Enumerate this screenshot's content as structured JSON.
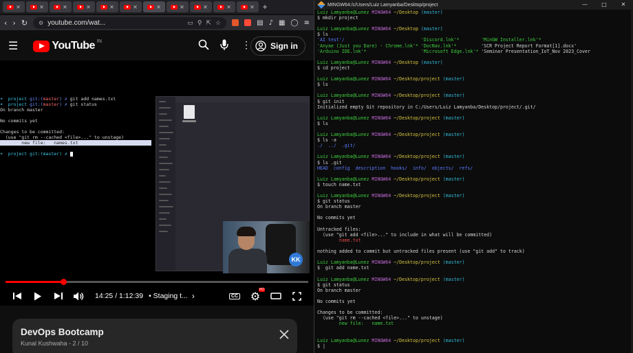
{
  "browser": {
    "tabs": [
      "yt",
      "yt",
      "yt",
      "yt",
      "yt",
      "yt",
      "yt",
      "yt",
      "yt",
      "yt",
      "yt"
    ],
    "url": "youtube.com/wat...",
    "nav_back": "‹",
    "nav_forward": "›",
    "reload": "↻"
  },
  "youtube": {
    "logo_text": "YouTube",
    "country": "IN",
    "signin_label": "Sign in",
    "video_terminal": [
      {
        "prompt": "➜  project ",
        "git": "git:(",
        "branch": "master",
        "end": ") ✗ ",
        "cmd": "git add names.txt"
      },
      {
        "prompt": "➜  project ",
        "git": "git:(",
        "branch": "master",
        "end": ") ✗ ",
        "cmd": "git status"
      }
    ],
    "video_lines": [
      "On branch master",
      "",
      "No commits yet",
      "",
      "Changes to be committed:",
      "  (use \"git rm --cached <file>...\" to unstage)"
    ],
    "video_highlight": "        new file:   names.txt",
    "video_last_prompt": "➜  project git:(master) ✗ ",
    "webcam_badge": "KK",
    "progress": 0.19,
    "timecode": "14:25 / 1:12:39",
    "chapter": "• Staging t...",
    "playlist_title": "DevOps Bootcamp",
    "playlist_sub": "Kunal Kushwaha - 2 / 10"
  },
  "terminal": {
    "title": "MINGW64:/c/Users/Luiz Lamyanba/Desktop/project",
    "lines": [
      {
        "t": "prompt",
        "path": "~/Desktop",
        "branch": "(master)"
      },
      {
        "t": "text",
        "v": "$ mkdir project"
      },
      {
        "t": "blank"
      },
      {
        "t": "prompt",
        "path": "~/Desktop",
        "branch": "(master)"
      },
      {
        "t": "text",
        "v": "$ ls"
      },
      {
        "t": "ls",
        "v": [
          [
            "'AI test'/",
            "'Discord.lnk'*",
            "'MinGW Installer.lnk'*"
          ],
          [
            "'Anyae (Just you Dare) - Chrome.lnk'*",
            "'DocNav.lnk'*",
            "'SCR Project Report Format[1].docx'"
          ],
          [
            "'Arduino IDE.lnk'*",
            "'Microsoft Edge.lnk'*",
            "'Seminar Presentation_IoT_Nov 2023_Cover"
          ]
        ]
      },
      {
        "t": "blank"
      },
      {
        "t": "prompt",
        "path": "~/Desktop",
        "branch": "(master)"
      },
      {
        "t": "text",
        "v": "$ cd project"
      },
      {
        "t": "blank"
      },
      {
        "t": "prompt",
        "path": "~/Desktop/project",
        "branch": "(master)"
      },
      {
        "t": "text",
        "v": "$ ls"
      },
      {
        "t": "blank"
      },
      {
        "t": "prompt",
        "path": "~/Desktop/project",
        "branch": "(master)"
      },
      {
        "t": "text",
        "v": "$ git init"
      },
      {
        "t": "text",
        "v": "Initialized empty Git repository in C:/Users/Luiz Lamyanba/Desktop/project/.git/"
      },
      {
        "t": "blank"
      },
      {
        "t": "prompt",
        "path": "~/Desktop/project",
        "branch": "(master)"
      },
      {
        "t": "text",
        "v": "$ ls"
      },
      {
        "t": "blank"
      },
      {
        "t": "prompt",
        "path": "~/Desktop/project",
        "branch": "(master)"
      },
      {
        "t": "text",
        "v": "$ ls -a"
      },
      {
        "t": "dirs",
        "v": "./  ../  .git/"
      },
      {
        "t": "blank"
      },
      {
        "t": "prompt",
        "path": "~/Desktop/project",
        "branch": "(master)"
      },
      {
        "t": "text",
        "v": "$ ls .git"
      },
      {
        "t": "gitls",
        "v": "HEAD  config  description  hooks/  info/  objects/  refs/"
      },
      {
        "t": "blank"
      },
      {
        "t": "prompt",
        "path": "~/Desktop/project",
        "branch": "(master)"
      },
      {
        "t": "text",
        "v": "$ touch name.txt"
      },
      {
        "t": "blank"
      },
      {
        "t": "prompt",
        "path": "~/Desktop/project",
        "branch": "(master)"
      },
      {
        "t": "text",
        "v": "$ git status"
      },
      {
        "t": "text",
        "v": "On branch master"
      },
      {
        "t": "blank"
      },
      {
        "t": "text",
        "v": "No commits yet"
      },
      {
        "t": "blank"
      },
      {
        "t": "text",
        "v": "Untracked files:"
      },
      {
        "t": "text",
        "v": "  (use \"git add <file>...\" to include in what will be committed)"
      },
      {
        "t": "red",
        "v": "        name.txt"
      },
      {
        "t": "blank"
      },
      {
        "t": "text",
        "v": "nothing added to commit but untracked files present (use \"git add\" to track)"
      },
      {
        "t": "blank"
      },
      {
        "t": "prompt",
        "path": "~/Desktop/project",
        "branch": "(master)"
      },
      {
        "t": "text",
        "v": "$  git add name.txt"
      },
      {
        "t": "blank"
      },
      {
        "t": "prompt",
        "path": "~/Desktop/project",
        "branch": "(master)"
      },
      {
        "t": "text",
        "v": "$ git status"
      },
      {
        "t": "text",
        "v": "On branch master"
      },
      {
        "t": "blank"
      },
      {
        "t": "text",
        "v": "No commits yet"
      },
      {
        "t": "blank"
      },
      {
        "t": "text",
        "v": "Changes to be committed:"
      },
      {
        "t": "text",
        "v": "  (use \"git rm --cached <file>...\" to unstage)"
      },
      {
        "t": "green",
        "v": "        new file:   name.txt"
      },
      {
        "t": "blank"
      },
      {
        "t": "blank"
      },
      {
        "t": "prompt",
        "path": "~/Desktop/project",
        "branch": "(master)"
      },
      {
        "t": "text",
        "v": "$ |"
      }
    ],
    "user": "Luiz Lamyanba@Lunez",
    "shell": "MINGW64"
  }
}
